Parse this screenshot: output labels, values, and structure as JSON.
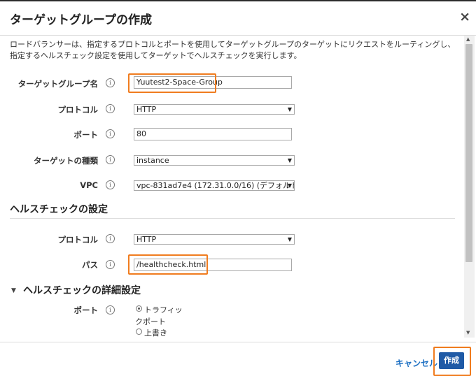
{
  "dialog": {
    "title": "ターゲットグループの作成",
    "close_label": "×",
    "description": "ロードバランサーは、指定するプロトコルとポートを使用してターゲットグループのターゲットにリクエストをルーティングし、指定するヘルスチェック設定を使用してターゲットでヘルスチェックを実行します。"
  },
  "form": {
    "target_group_name": {
      "label": "ターゲットグループ名",
      "value": "Yuutest2-Space-Group"
    },
    "protocol": {
      "label": "プロトコル",
      "value": "HTTP"
    },
    "port": {
      "label": "ポート",
      "value": "80"
    },
    "target_type": {
      "label": "ターゲットの種類",
      "value": "instance"
    },
    "vpc": {
      "label": "VPC",
      "value": "vpc-831ad7e4 (172.31.0.0/16) (デフォルト\\"
    }
  },
  "health_check": {
    "section_title": "ヘルスチェックの設定",
    "protocol": {
      "label": "プロトコル",
      "value": "HTTP"
    },
    "path": {
      "label": "パス",
      "value": "/healthcheck.html"
    }
  },
  "advanced": {
    "section_title": "ヘルスチェックの詳細設定",
    "port": {
      "label": "ポート",
      "option_traffic_line1": "トラフィッ",
      "option_traffic_line2": "クポート",
      "option_override": "上書き"
    }
  },
  "info_icon_glyph": "i",
  "footer": {
    "cancel_label": "キャンセル",
    "create_label": "作成"
  },
  "colors": {
    "highlight": "#f07c1f",
    "primary_button": "#1f5aa6",
    "link": "#1a6ec2"
  }
}
